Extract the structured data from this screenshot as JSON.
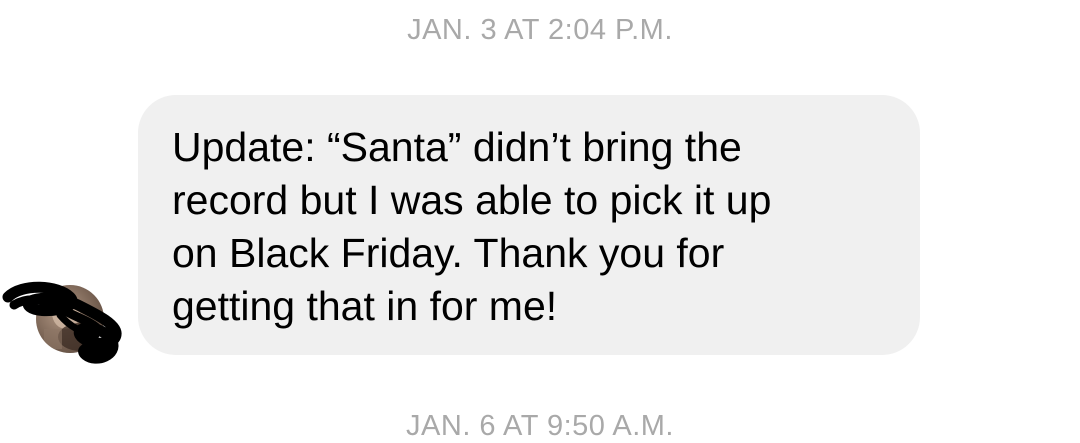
{
  "thread": {
    "timestamp_top": "JAN. 3 AT 2:04 P.M.",
    "timestamp_bottom": "JAN. 6 AT 9:50 A.M.",
    "message": {
      "sender_avatar_icon": "avatar-icon",
      "text": "Update: “Santa” didn’t bring the\nrecord but I was able to pick it up\non Black Friday. Thank you for\ngetting that in for me!"
    }
  },
  "colors": {
    "bubble_background": "#f0f0f0",
    "timestamp_text": "#a9a9a9",
    "message_text": "#000000",
    "redaction_scribble": "#000000"
  }
}
